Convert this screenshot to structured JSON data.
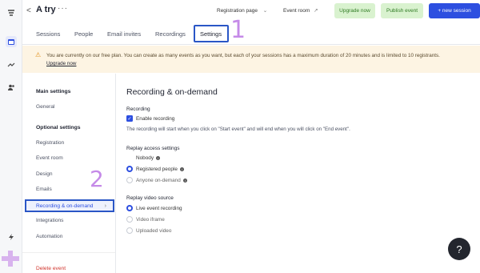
{
  "header": {
    "back_glyph": "<",
    "event_title": "A try",
    "more_glyph": "···",
    "registration_page": "Registration page",
    "event_room": "Event room",
    "upgrade_now": "Upgrade now",
    "publish_event": "Publish event",
    "new_session": "+ new session"
  },
  "tabs": {
    "sessions": "Sessions",
    "people": "People",
    "email_invites": "Email invites",
    "recordings": "Recordings",
    "settings": "Settings"
  },
  "annotations": {
    "one": "1",
    "two": "2"
  },
  "warning": {
    "text": "You are currently on our free plan. You can create as many events as you want, but each of your sessions has a maximum duration of 20 minutes and is limited to 10 registrants.",
    "link": "Upgrade now"
  },
  "sidebar": {
    "main_heading": "Main settings",
    "general": "General",
    "optional_heading": "Optional settings",
    "registration": "Registration",
    "event_room": "Event room",
    "design": "Design",
    "emails": "Emails",
    "recording": "Recording & on-demand",
    "integrations": "Integrations",
    "automation": "Automation",
    "delete_event": "Delete event",
    "chevron": "›"
  },
  "main": {
    "title": "Recording & on-demand",
    "recording_label": "Recording",
    "enable_recording": "Enable recording",
    "recording_help": "The recording will start when you click on \"Start event\" and will end when you will click on \"End event\".",
    "replay_label": "Replay access settings",
    "nobody": "Nobody",
    "registered": "Registered people",
    "anyone": "Anyone on-demand",
    "video_source_label": "Replay video source",
    "live_event": "Live event recording",
    "video_iframe": "Video iframe",
    "uploaded_video": "Uploaded video"
  },
  "help_fab": "?",
  "colors": {
    "accent": "#2d4fe0",
    "success_bg": "#d9f2cf",
    "warning_bg": "#fdf4e3",
    "annotation_box": "#2a56c6",
    "annotation_number": "#c58ae8"
  }
}
